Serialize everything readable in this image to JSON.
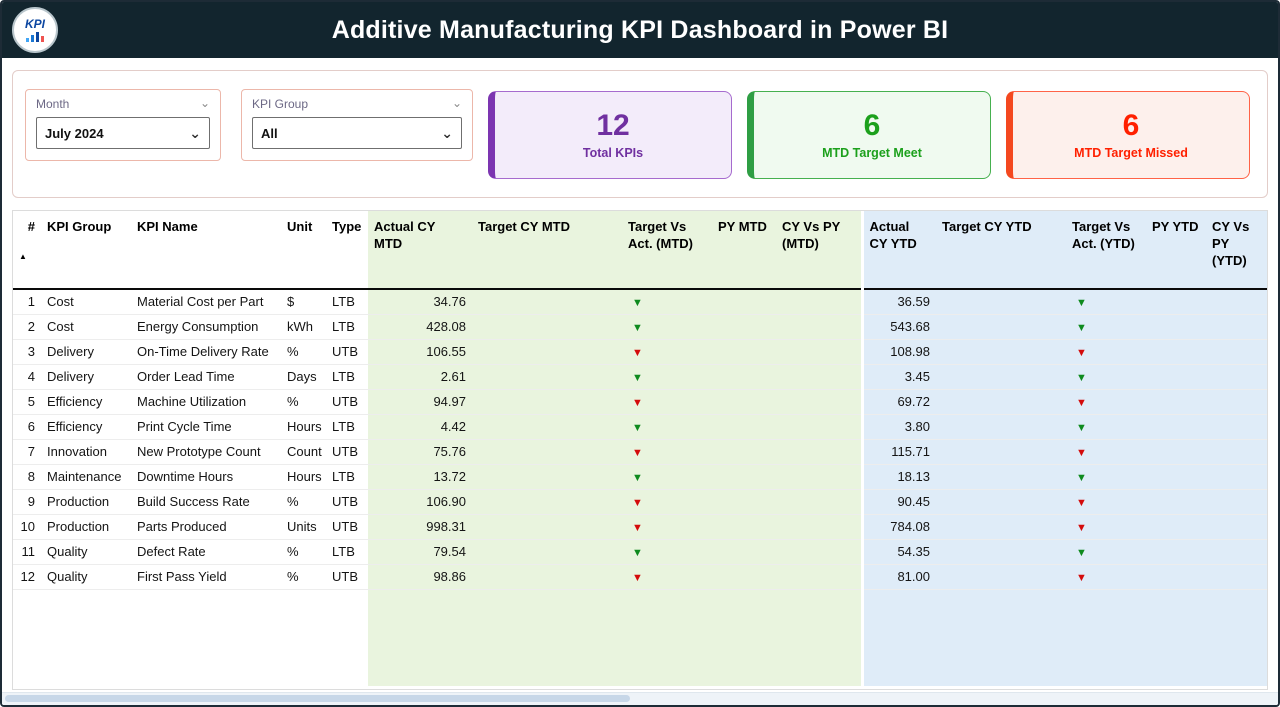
{
  "header": {
    "title": "Additive Manufacturing KPI Dashboard in Power BI",
    "logo_text": "KPI"
  },
  "icons": {
    "dropdown_chevron": "⌄",
    "sort_ascending": "▲",
    "down_arrow": "▼"
  },
  "filters": {
    "month": {
      "label": "Month",
      "value": "July 2024"
    },
    "kpi_group": {
      "label": "KPI Group",
      "value": "All"
    }
  },
  "cards": [
    {
      "value": "12",
      "label": "Total KPIs",
      "color": "#7030a0"
    },
    {
      "value": "6",
      "label": "MTD Target Meet",
      "color": "#1ca01c"
    },
    {
      "value": "6",
      "label": "MTD Target Missed",
      "color": "#ff2000"
    }
  ],
  "table": {
    "columns": [
      "#",
      "KPI Group",
      "KPI Name",
      "Unit",
      "Type",
      "Actual CY MTD",
      "Target CY MTD",
      "Target Vs Act. (MTD)",
      "PY MTD",
      "CY Vs PY (MTD)",
      "Actual CY YTD",
      "Target CY YTD",
      "Target Vs Act. (YTD)",
      "PY YTD",
      "CY Vs PY (YTD)"
    ],
    "rows": [
      {
        "num": "1",
        "group": "Cost",
        "name": "Material Cost per Part",
        "unit": "$",
        "type": "LTB",
        "actual_mtd": "34.76",
        "target_mtd": "",
        "mtd_arrow": "green",
        "py_mtd": "",
        "cy_vs_py_mtd": "",
        "actual_ytd": "36.59",
        "target_ytd": "",
        "ytd_arrow": "green",
        "py_ytd": "",
        "cy_vs_py_ytd": ""
      },
      {
        "num": "2",
        "group": "Cost",
        "name": "Energy Consumption",
        "unit": "kWh",
        "type": "LTB",
        "actual_mtd": "428.08",
        "target_mtd": "",
        "mtd_arrow": "green",
        "py_mtd": "",
        "cy_vs_py_mtd": "",
        "actual_ytd": "543.68",
        "target_ytd": "",
        "ytd_arrow": "green",
        "py_ytd": "",
        "cy_vs_py_ytd": ""
      },
      {
        "num": "3",
        "group": "Delivery",
        "name": "On-Time Delivery Rate",
        "unit": "%",
        "type": "UTB",
        "actual_mtd": "106.55",
        "target_mtd": "",
        "mtd_arrow": "red",
        "py_mtd": "",
        "cy_vs_py_mtd": "",
        "actual_ytd": "108.98",
        "target_ytd": "",
        "ytd_arrow": "red",
        "py_ytd": "",
        "cy_vs_py_ytd": ""
      },
      {
        "num": "4",
        "group": "Delivery",
        "name": "Order Lead Time",
        "unit": "Days",
        "type": "LTB",
        "actual_mtd": "2.61",
        "target_mtd": "",
        "mtd_arrow": "green",
        "py_mtd": "",
        "cy_vs_py_mtd": "",
        "actual_ytd": "3.45",
        "target_ytd": "",
        "ytd_arrow": "green",
        "py_ytd": "",
        "cy_vs_py_ytd": ""
      },
      {
        "num": "5",
        "group": "Efficiency",
        "name": "Machine Utilization",
        "unit": "%",
        "type": "UTB",
        "actual_mtd": "94.97",
        "target_mtd": "",
        "mtd_arrow": "red",
        "py_mtd": "",
        "cy_vs_py_mtd": "",
        "actual_ytd": "69.72",
        "target_ytd": "",
        "ytd_arrow": "red",
        "py_ytd": "",
        "cy_vs_py_ytd": ""
      },
      {
        "num": "6",
        "group": "Efficiency",
        "name": "Print Cycle Time",
        "unit": "Hours",
        "type": "LTB",
        "actual_mtd": "4.42",
        "target_mtd": "",
        "mtd_arrow": "green",
        "py_mtd": "",
        "cy_vs_py_mtd": "",
        "actual_ytd": "3.80",
        "target_ytd": "",
        "ytd_arrow": "green",
        "py_ytd": "",
        "cy_vs_py_ytd": ""
      },
      {
        "num": "7",
        "group": "Innovation",
        "name": "New Prototype Count",
        "unit": "Count",
        "type": "UTB",
        "actual_mtd": "75.76",
        "target_mtd": "",
        "mtd_arrow": "red",
        "py_mtd": "",
        "cy_vs_py_mtd": "",
        "actual_ytd": "115.71",
        "target_ytd": "",
        "ytd_arrow": "red",
        "py_ytd": "",
        "cy_vs_py_ytd": ""
      },
      {
        "num": "8",
        "group": "Maintenance",
        "name": "Downtime Hours",
        "unit": "Hours",
        "type": "LTB",
        "actual_mtd": "13.72",
        "target_mtd": "",
        "mtd_arrow": "green",
        "py_mtd": "",
        "cy_vs_py_mtd": "",
        "actual_ytd": "18.13",
        "target_ytd": "",
        "ytd_arrow": "green",
        "py_ytd": "",
        "cy_vs_py_ytd": ""
      },
      {
        "num": "9",
        "group": "Production",
        "name": "Build Success Rate",
        "unit": "%",
        "type": "UTB",
        "actual_mtd": "106.90",
        "target_mtd": "",
        "mtd_arrow": "red",
        "py_mtd": "",
        "cy_vs_py_mtd": "",
        "actual_ytd": "90.45",
        "target_ytd": "",
        "ytd_arrow": "red",
        "py_ytd": "",
        "cy_vs_py_ytd": ""
      },
      {
        "num": "10",
        "group": "Production",
        "name": "Parts Produced",
        "unit": "Units",
        "type": "UTB",
        "actual_mtd": "998.31",
        "target_mtd": "",
        "mtd_arrow": "red",
        "py_mtd": "",
        "cy_vs_py_mtd": "",
        "actual_ytd": "784.08",
        "target_ytd": "",
        "ytd_arrow": "red",
        "py_ytd": "",
        "cy_vs_py_ytd": ""
      },
      {
        "num": "11",
        "group": "Quality",
        "name": "Defect Rate",
        "unit": "%",
        "type": "LTB",
        "actual_mtd": "79.54",
        "target_mtd": "",
        "mtd_arrow": "green",
        "py_mtd": "",
        "cy_vs_py_mtd": "",
        "actual_ytd": "54.35",
        "target_ytd": "",
        "ytd_arrow": "green",
        "py_ytd": "",
        "cy_vs_py_ytd": ""
      },
      {
        "num": "12",
        "group": "Quality",
        "name": "First Pass Yield",
        "unit": "%",
        "type": "UTB",
        "actual_mtd": "98.86",
        "target_mtd": "",
        "mtd_arrow": "red",
        "py_mtd": "",
        "cy_vs_py_mtd": "",
        "actual_ytd": "81.00",
        "target_ytd": "",
        "ytd_arrow": "red",
        "py_ytd": "",
        "cy_vs_py_ytd": ""
      }
    ]
  },
  "colors": {
    "header_bg": "#12252e",
    "mtd_bg": "#e9f4de",
    "ytd_bg": "#dfecf8",
    "arrow_green": "#0e8a1e",
    "arrow_red": "#d40b0b",
    "purple": "#7030a0",
    "green": "#1ca01c",
    "red": "#ff2000"
  }
}
